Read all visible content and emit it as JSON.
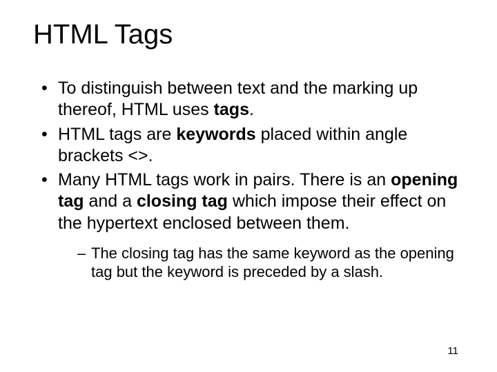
{
  "title": "HTML Tags",
  "bullets": [
    {
      "pre": "To distinguish between text and the marking up thereof, HTML uses ",
      "bold": "tags",
      "post": "."
    },
    {
      "pre": "HTML tags are ",
      "bold": "keywords",
      "post": " placed within angle brackets <>."
    },
    {
      "pre": "Many HTML tags work in pairs. There is an ",
      "bold": "opening tag",
      "mid": " and a ",
      "bold2": "closing tag",
      "post": " which impose their effect on the hypertext enclosed between them."
    }
  ],
  "sub": {
    "text": "The closing tag has the same keyword as the opening tag but the keyword is preceded by a slash."
  },
  "page_number": "11"
}
